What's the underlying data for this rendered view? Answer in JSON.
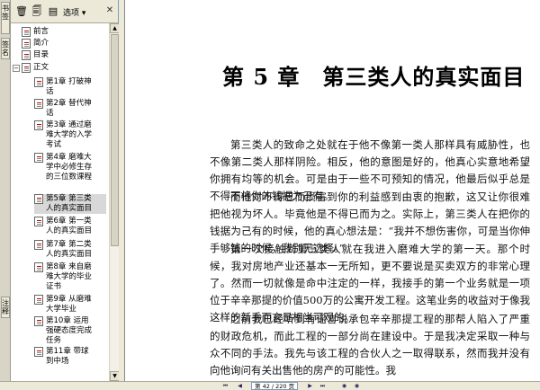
{
  "side_tabs": [
    {
      "label": "书签"
    },
    {
      "label": "签名"
    },
    {
      "label": "注释"
    }
  ],
  "bookmarks_toolbar": {
    "options_label": "选项",
    "close_glyph": "✕"
  },
  "tree": [
    {
      "label": "前言"
    },
    {
      "label": "简介"
    },
    {
      "label": "目录"
    },
    {
      "label": "正文"
    },
    {
      "label": "第1章 打破神话"
    },
    {
      "label": "第2章 替代神话"
    },
    {
      "label": "第3章 通过磨难大学的入学考试"
    },
    {
      "label": "第4章 磨难大学中必修生存的三位数课程"
    },
    {
      "label": "第5章 第三类人的真实面目"
    },
    {
      "label": "第6章 第一类人的真实面目"
    },
    {
      "label": "第7章 第二类人的真实面目"
    },
    {
      "label": "第8章 来自磨难大学的毕业证书"
    },
    {
      "label": "第9章 从磨难大学毕业"
    },
    {
      "label": "第10章 运用强硬态度完成任务"
    },
    {
      "label": "第11章 带球到中场"
    }
  ],
  "document": {
    "chapter_title": "第 5 章　第三类人的真实面目",
    "paragraphs": [
      "第三类人的致命之处就在于他不像第一类人那样具有威胁性，也不像第二类人那样阴险。相反，他的意图是好的，他真心实意地希望你拥有均等的机会。可是由于一些不可预知的情况，他最后似乎总是不得不将你的钱据为己有。",
      "而他对不得已而损害到你的利益感到由衷的抱歉，这又让你很难把他视为坏人。毕竟他是不得已而为之。实际上，第三类人在把你的钱据为己有的时候，他的真心想法是：“我并不想伤害你，可是当你伸手够钱的时候，我别无选择。”",
      "第一次接触到第三类人就在我进入磨难大学的第一天。那个时候，我对房地产业还基本一无所知，更不要说是买卖双方的非常心理了。然而一切就像是命中注定的一样，我接手的第一个业务就是一项位于辛辛那提的价值500万的公寓开发工程。这笔业务的收益对于像我这样的新手而言是相当可观的。",
      "之前我已经听到有谣言说承包辛辛那提工程的那帮人陷入了严重的财政危机，而此工程的一部分尚在建设中。于是我决定采取一种与众不同的手法。我先与该工程的合伙人之一取得联系，然而我并没有向他询问有关出售他的房产的可能性。我"
    ]
  },
  "statusbar": {
    "page_indicator": "第 42 / 220 页"
  }
}
